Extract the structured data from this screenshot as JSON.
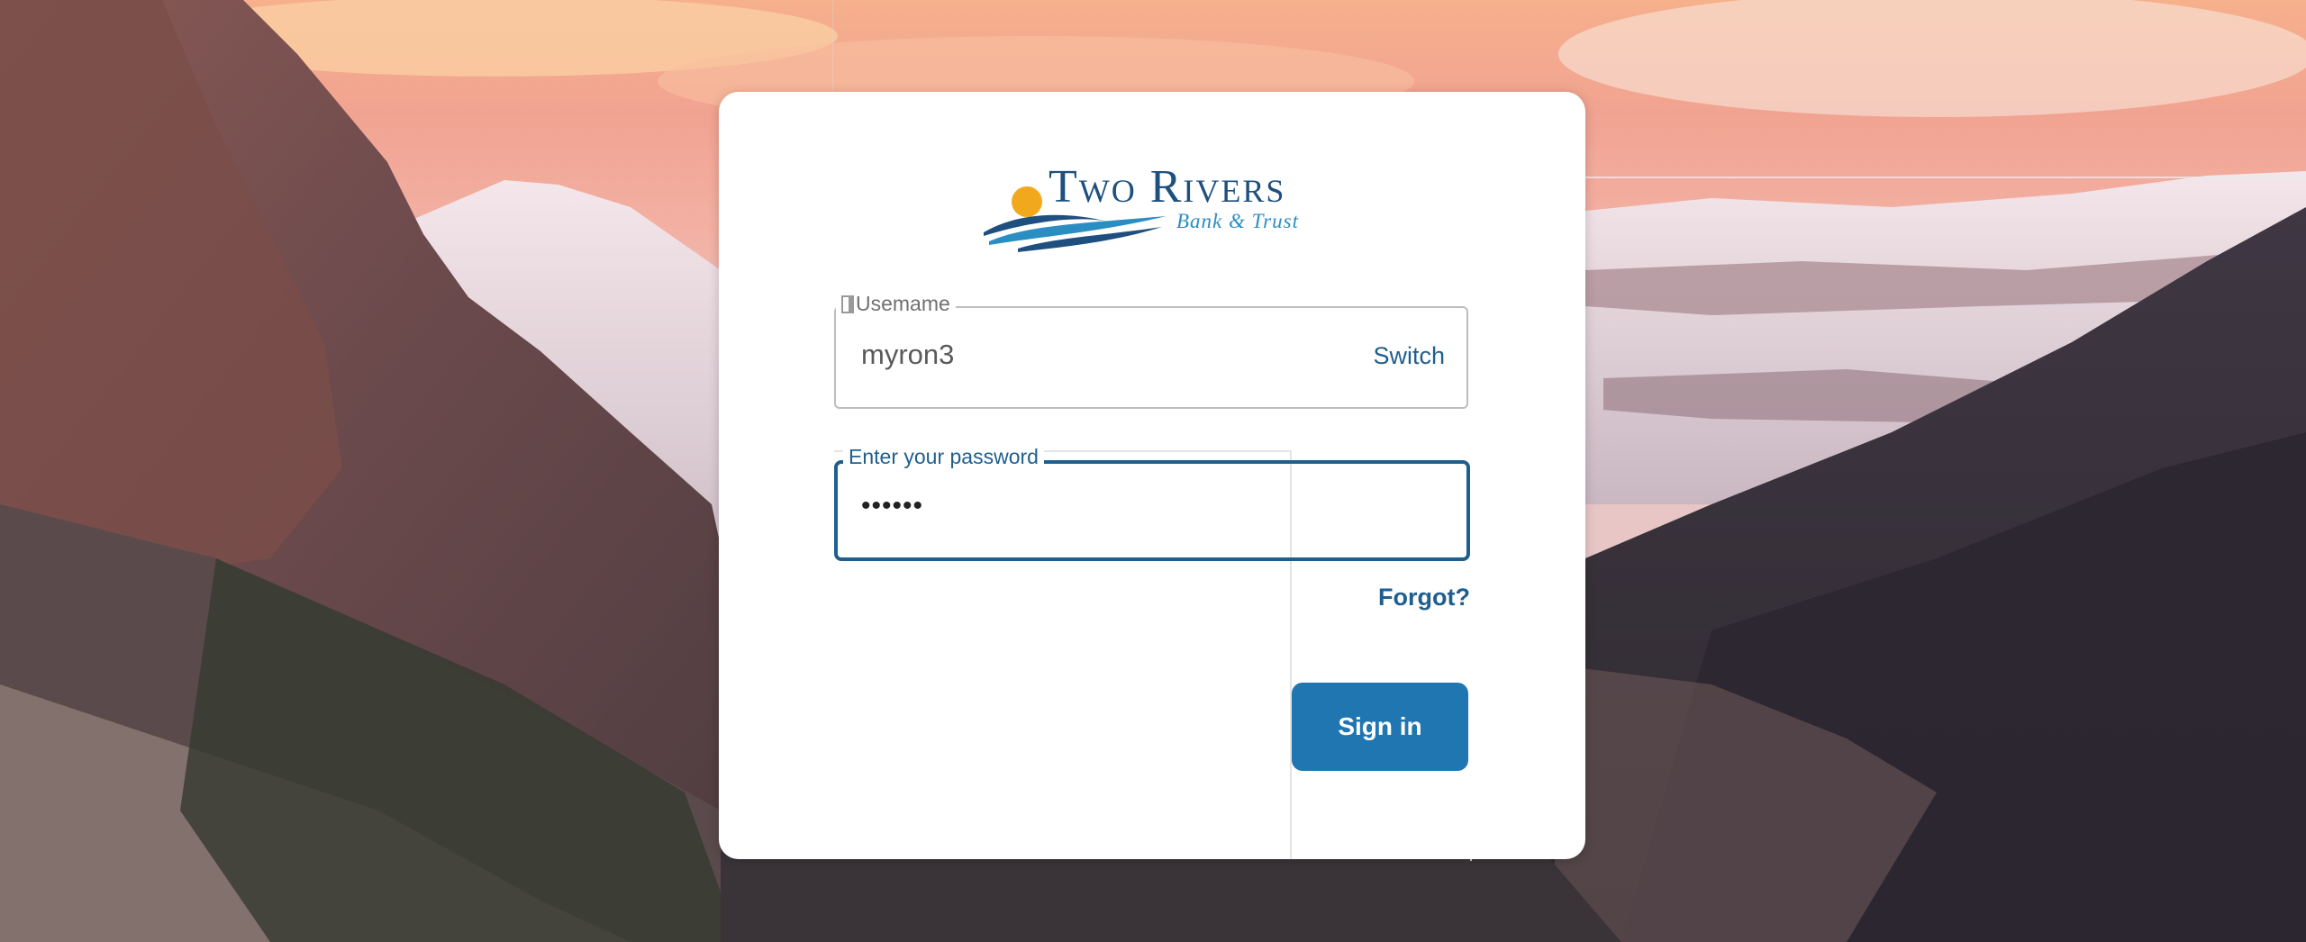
{
  "brand": {
    "name": "Two Rivers",
    "subtitle": "Bank & Trust",
    "colors": {
      "navy": "#1e4f7e",
      "blue": "#2a8ec2",
      "sun": "#f2a81d"
    }
  },
  "login": {
    "username": {
      "label": "Usemame",
      "value": "myron3",
      "switch_label": "Switch"
    },
    "password": {
      "label": "Enter your password",
      "masked_value": "••••••"
    },
    "forgot_label": "Forgot?",
    "signin_label": "Sign in"
  },
  "icons": {
    "logo_mark": "sun-over-waves-icon"
  },
  "colors": {
    "accent": "#1f5f8f",
    "button": "#1f76b1",
    "card": "#ffffff"
  }
}
